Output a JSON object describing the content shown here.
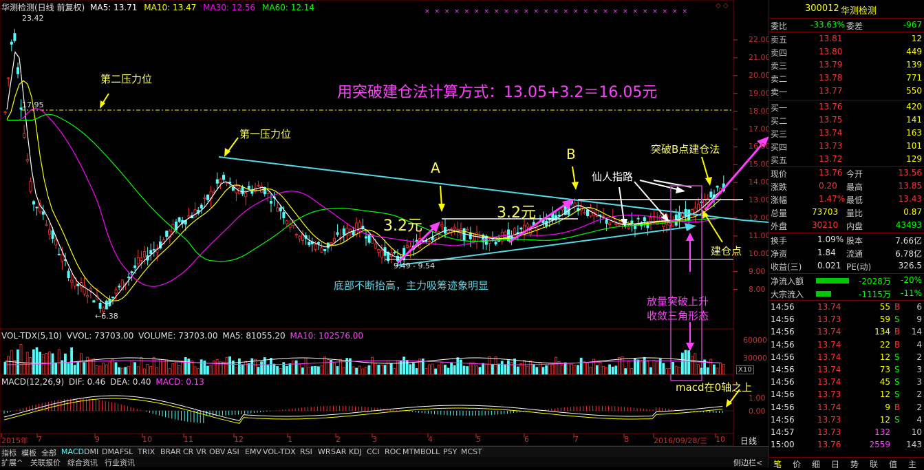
{
  "header": {
    "title": "华测检测(日线 前复权)",
    "ma5": "MA5: 13.71",
    "ma10": "MA10: 13.47",
    "ma30": "MA30: 12.56",
    "ma60": "MA60: 12.14"
  },
  "price_axis": [
    "22.00",
    "21.00",
    "20.00",
    "19.00",
    "18.00",
    "17.00",
    "16.00",
    "15.00",
    "14.00",
    "13.00",
    "12.00",
    "11.00",
    "10.00",
    "9.00",
    "8.00"
  ],
  "price_marks": {
    "high": "23.42",
    "p1795": "17.95",
    "low": "←6.38",
    "range": "9.49 - 9.54"
  },
  "annotations": {
    "formula": "用突破建仓法计算方式：13.05+3.2＝16.05元",
    "second_pressure": "第二压力位",
    "first_pressure": "第一压力位",
    "point_a": "A",
    "point_b": "B",
    "rise1": "3.2元",
    "rise2": "3.2元",
    "xianren": "仙人指路",
    "breakout_b": "突破B点建仓法",
    "entry_point": "建仓点",
    "bottom_rising": "底部不断抬高，主力吸筹迹象明显",
    "volume_break1": "放量突破上升",
    "volume_break2": "收敛三角形态",
    "macd_above": "macd在0轴之上"
  },
  "volume_header": {
    "name": "VOL-TDX(5,10)",
    "vvol": "VVOL: 73703.00",
    "volume": "VOLUME: 73703.00",
    "ma5": "MA5: 81055.20",
    "ma10": "MA10: 102576.00"
  },
  "volume_axis": [
    "60000",
    "30000",
    "X10"
  ],
  "macd_header": {
    "name": "MACD(12,26,9)",
    "dif": "DIF: 0.46",
    "dea": "DEA: 0.40",
    "macd": "MACD: 0.13"
  },
  "macd_axis": [
    "1.00",
    "0.00"
  ],
  "x_axis": [
    "2015年",
    "7",
    "9",
    "10",
    "11",
    "12",
    "1",
    "2",
    "3",
    "4",
    "5",
    "6",
    "7",
    "8",
    "2016/09/28/三",
    "10"
  ],
  "timeframe_label": "日线",
  "indicator_tabs": [
    "指标",
    "模板",
    "全部",
    "MACD",
    "DMI",
    "DMA",
    "FSL",
    "TRIX",
    "BRAR",
    "CR",
    "VR",
    "OBV",
    "ASI",
    "EMV",
    "VOL-TDX",
    "RSI",
    "WR",
    "SAR",
    "KDJ",
    "CCI",
    "ROC",
    "MTM",
    "BOLL",
    "PSY",
    "MCST"
  ],
  "extra_tabs": [
    "扩展^",
    "关联报价",
    "综合资讯",
    "行业资讯"
  ],
  "stock": {
    "code": "300012",
    "name": "华测检测"
  },
  "order_book": {
    "ratio_label": "委比",
    "ratio": "-33.63%",
    "diff_label": "委差",
    "diff": "-967",
    "asks": [
      {
        "label": "卖五",
        "price": "13.81",
        "vol": "12"
      },
      {
        "label": "卖四",
        "price": "13.80",
        "vol": "449"
      },
      {
        "label": "卖三",
        "price": "13.79",
        "vol": "139"
      },
      {
        "label": "卖二",
        "price": "13.78",
        "vol": "771"
      },
      {
        "label": "卖一",
        "price": "13.77",
        "vol": "550"
      }
    ],
    "bids": [
      {
        "label": "买一",
        "price": "13.76",
        "vol": "420"
      },
      {
        "label": "买二",
        "price": "13.75",
        "vol": "141"
      },
      {
        "label": "买三",
        "price": "13.74",
        "vol": "163"
      },
      {
        "label": "买四",
        "price": "13.73",
        "vol": "101"
      },
      {
        "label": "买五",
        "price": "13.72",
        "vol": "129"
      }
    ]
  },
  "quote": [
    {
      "l1": "现价",
      "v1": "13.76",
      "l2": "今开",
      "v2": "13.56"
    },
    {
      "l1": "涨跌",
      "v1": "0.20",
      "l2": "最高",
      "v2": "13.85"
    },
    {
      "l1": "涨幅",
      "v1": "1.47%",
      "l2": "最低",
      "v2": "13.43"
    },
    {
      "l1": "总量",
      "v1": "73703",
      "l2": "量比",
      "v2": "0.87"
    },
    {
      "l1": "外盘",
      "v1": "30210",
      "l2": "内盘",
      "v2": "43493"
    }
  ],
  "fundamentals": [
    {
      "l1": "换手",
      "v1": "1.09%",
      "l2": "股本",
      "v2": "7.66亿"
    },
    {
      "l1": "净资",
      "v1": "1.84",
      "l2": "流通",
      "v2": "6.78亿"
    },
    {
      "l1": "收益(三)",
      "v1": "0.021",
      "l2": "PE(动)",
      "v2": "326.5"
    }
  ],
  "flows": [
    {
      "label": "净流入额",
      "amount": "-2028万",
      "pct": "-20%"
    },
    {
      "label": "大宗流入",
      "amount": "-1115万",
      "pct": "-11%"
    }
  ],
  "ticks": [
    {
      "time": "14:56",
      "price": "13.74",
      "vol": "55",
      "side": "B",
      "n": "6"
    },
    {
      "time": "14:56",
      "price": "13.73",
      "vol": "59",
      "side": "S",
      "n": "9"
    },
    {
      "time": "14:56",
      "price": "13.74",
      "vol": "134",
      "side": "B",
      "n": "14"
    },
    {
      "time": "14:56",
      "price": "13.74",
      "vol": "22",
      "side": "B",
      "n": "4"
    },
    {
      "time": "14:56",
      "price": "13.74",
      "vol": "12",
      "side": "S",
      "n": "2"
    },
    {
      "time": "14:56",
      "price": "13.74",
      "vol": "73",
      "side": "S",
      "n": "3"
    },
    {
      "time": "14:56",
      "price": "13.74",
      "vol": "45",
      "side": "S",
      "n": "3"
    },
    {
      "time": "14:56",
      "price": "13.73",
      "vol": "12",
      "side": "S",
      "n": "2"
    },
    {
      "time": "14:56",
      "price": "13.74",
      "vol": "9",
      "side": "B",
      "n": "2"
    },
    {
      "time": "14:56",
      "price": "13.73",
      "vol": "12",
      "side": "S",
      "n": "4"
    },
    {
      "time": "14:57",
      "price": "13.73",
      "vol": "132",
      "side": "",
      "n": "10"
    },
    {
      "time": "15:00",
      "price": "13.76",
      "vol": "2559",
      "side": "",
      "n": "143"
    }
  ],
  "bottom_tabs": [
    "笔",
    "价",
    "细",
    "日",
    "势",
    "联",
    "值",
    "主"
  ],
  "side_bar_label": "侧边栏<",
  "colors": {
    "up": "#ff3232",
    "down": "#54fcfc",
    "ma5": "#ffffff",
    "ma10": "#ffff00",
    "ma30": "#ff00ff",
    "ma60": "#00ff00",
    "axis": "#c83232"
  }
}
